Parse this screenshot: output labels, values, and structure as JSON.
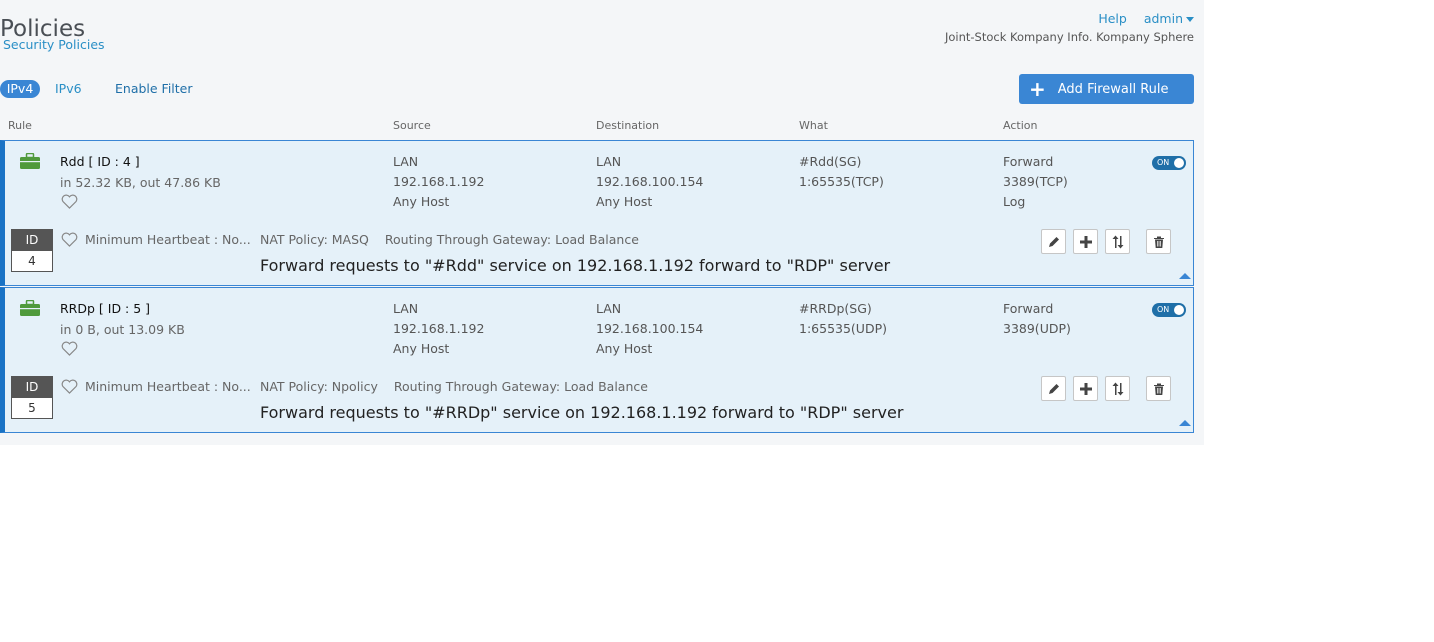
{
  "header": {
    "title": "Policies",
    "breadcrumb": "Security Policies",
    "help": "Help",
    "user": "admin",
    "company": "Joint-Stock Kompany Info. Kompany Sphere"
  },
  "toolbar": {
    "tabs": [
      "IPv4",
      "IPv6"
    ],
    "active_tab": "IPv4",
    "filter_label": "Enable Filter",
    "add_button": "Add Firewall Rule"
  },
  "columns": {
    "rule": "Rule",
    "source": "Source",
    "destination": "Destination",
    "what": "What",
    "action": "Action"
  },
  "rules": [
    {
      "name": "Rdd  [ ID : 4 ]",
      "traffic": "in 52.32 KB, out 47.86 KB",
      "source": [
        "LAN",
        "192.168.1.192",
        "Any Host"
      ],
      "destination": [
        "LAN",
        "192.168.100.154",
        "Any Host"
      ],
      "what": [
        "#Rdd(SG)",
        "1:65535(TCP)"
      ],
      "action": [
        "Forward",
        "3389(TCP)",
        "Log"
      ],
      "toggle": "ON",
      "id_label": "ID",
      "id": "4",
      "heartbeat": "Minimum Heartbeat : No...",
      "nat": "NAT Policy: MASQ",
      "routing": "Routing Through Gateway: Load Balance",
      "description": "Forward requests to \"#Rdd\" service on 192.168.1.192 forward to \"RDP\" server"
    },
    {
      "name": "RRDp  [ ID : 5 ]",
      "traffic": "in 0 B, out 13.09 KB",
      "source": [
        "LAN",
        "192.168.1.192",
        "Any Host"
      ],
      "destination": [
        "LAN",
        "192.168.100.154",
        "Any Host"
      ],
      "what": [
        "#RRDp(SG)",
        "1:65535(UDP)"
      ],
      "action": [
        "Forward",
        "3389(UDP)"
      ],
      "toggle": "ON",
      "id_label": "ID",
      "id": "5",
      "heartbeat": "Minimum Heartbeat : No...",
      "nat": "NAT Policy: Npolicy",
      "routing": "Routing Through Gateway: Load Balance",
      "description": "Forward requests to \"#RRDp\" service on 192.168.1.192 forward to \"RDP\" server"
    }
  ],
  "icons": {
    "rule_type": "briefcase-icon",
    "favorite": "heart-icon",
    "edit": "pencil-icon",
    "add": "plus-icon",
    "move": "move-arrows-icon",
    "delete": "trash-icon",
    "collapse": "caret-up-icon"
  },
  "colors": {
    "accent": "#3a86d4",
    "forward": "#4f9a3c",
    "row_background": "#e5f1f9"
  }
}
